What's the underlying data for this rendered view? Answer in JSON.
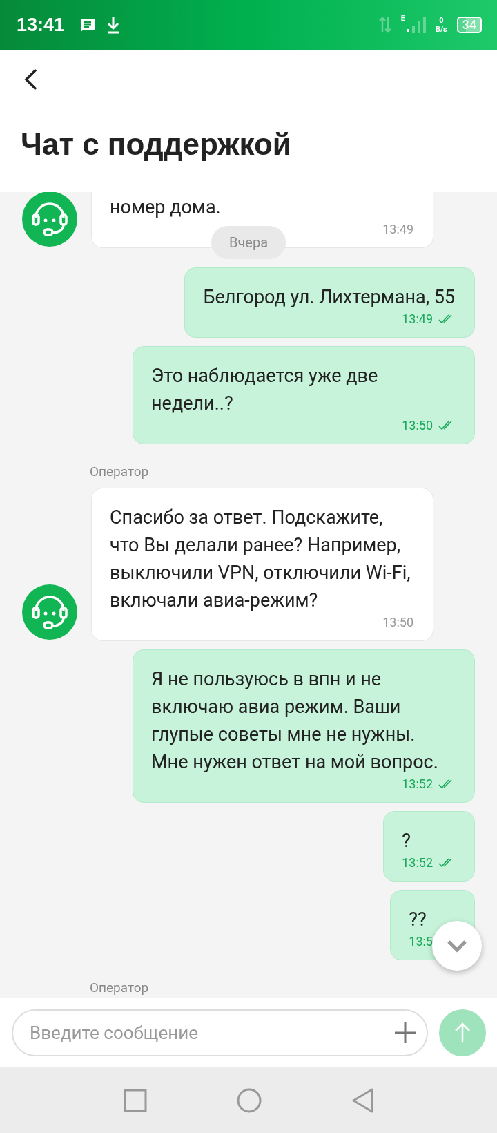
{
  "status_bar": {
    "time": "13:41",
    "network": "E",
    "speed_value": "0",
    "speed_unit": "B/s",
    "battery": "34"
  },
  "header": {
    "title": "Чат с поддержкой"
  },
  "messages": [
    {
      "kind": "incoming",
      "text": "номер дома.",
      "time": "13:49"
    },
    {
      "kind": "date",
      "text": "Вчера"
    },
    {
      "kind": "outgoing",
      "text": "Белгород ул. Лихтермана, 55",
      "time": "13:49",
      "read": true
    },
    {
      "kind": "outgoing",
      "text": "Это наблюдается уже две недели..?",
      "time": "13:50",
      "read": true
    },
    {
      "kind": "sender",
      "text": "Оператор"
    },
    {
      "kind": "incoming",
      "text": "Спасибо за ответ. Подскажите, что Вы делали ранее? Например, выключили VPN, отключили Wi-Fi, включали авиа-режим?",
      "time": "13:50"
    },
    {
      "kind": "outgoing",
      "text": "Я не пользуюсь в впн и не включаю авиа режим. Ваши глупые советы мне не нужны. Мне нужен ответ на мой вопрос.",
      "time": "13:52",
      "read": true
    },
    {
      "kind": "outgoing",
      "text": "?",
      "time": "13:52",
      "read": true
    },
    {
      "kind": "outgoing",
      "text": "??",
      "time": "13:5"
    },
    {
      "kind": "sender",
      "text": "Оператор"
    }
  ],
  "input": {
    "placeholder": "Введите сообщение"
  },
  "send_button": {
    "disabled": true
  }
}
